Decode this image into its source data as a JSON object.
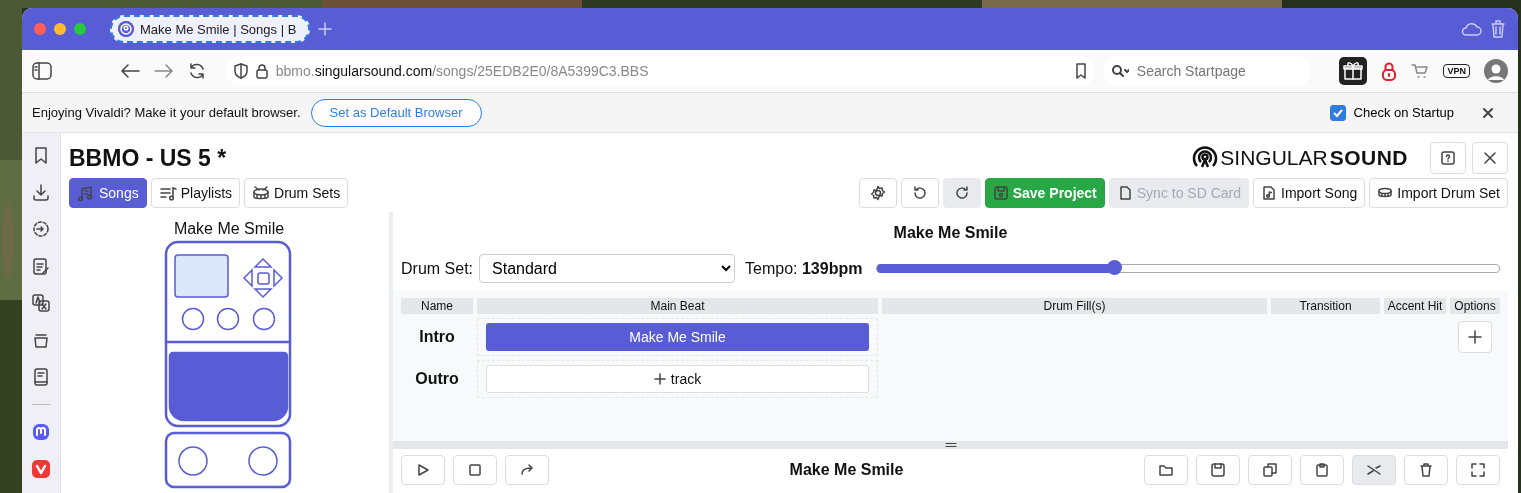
{
  "browser": {
    "tab": {
      "title": "Make Me Smile | Songs | B"
    },
    "address": {
      "host_prefix": "bbmo.",
      "host": "singularsound.com",
      "path": "/songs/25EDB2E0/8A5399C3.BBS"
    },
    "search": {
      "placeholder": "Search Startpage"
    },
    "vpn_badge": "VPN",
    "notice": {
      "text": "Enjoying Vivaldi? Make it your default browser.",
      "button": "Set as Default Browser",
      "checkbox": {
        "label": "Check on Startup",
        "checked": true
      }
    }
  },
  "app": {
    "title": "BBMO - US 5 *",
    "logo": {
      "light": "SINGULAR",
      "bold": "SOUND"
    },
    "tabs": [
      {
        "label": "Songs",
        "selected": true
      },
      {
        "label": "Playlists",
        "selected": false
      },
      {
        "label": "Drum Sets",
        "selected": false
      }
    ],
    "actions": [
      {
        "kind": "icon",
        "disabled": false
      },
      {
        "kind": "icon",
        "disabled": false
      },
      {
        "kind": "icon",
        "disabled": true
      },
      {
        "kind": "primary",
        "label": "Save Project",
        "disabled": false
      },
      {
        "kind": "plain",
        "label": "Sync to SD Card",
        "disabled": true
      },
      {
        "kind": "plain",
        "label": "Import Song",
        "disabled": false
      },
      {
        "kind": "plain",
        "label": "Import Drum Set",
        "disabled": false
      }
    ],
    "pedal": {
      "song": "Make Me Smile"
    },
    "song": {
      "title": "Make Me Smile",
      "drum_set_label": "Drum Set:",
      "drum_set": "Standard",
      "tempo": {
        "label": "Tempo: **139bpm**",
        "level": 0.38
      }
    },
    "table": {
      "columns": [
        "Name",
        "Main Beat",
        "Drum Fill(s)",
        "Transition",
        "Accent Hit",
        "Options"
      ],
      "rows": [
        {
          "name": "Intro",
          "main_beat": {
            "kind": "song",
            "label": "Make Me Smile"
          },
          "option_button": true
        },
        {
          "name": "Outro",
          "main_beat": {
            "kind": "add",
            "label": "track"
          },
          "option_button": false
        }
      ]
    },
    "editor": {
      "title": "Make Me Smile",
      "left_tools": [
        {
          "disabled": false
        },
        {
          "disabled": false
        },
        {
          "disabled": false
        }
      ],
      "right_tools": [
        {
          "disabled": false
        },
        {
          "disabled": false
        },
        {
          "disabled": false
        },
        {
          "disabled": false
        },
        {
          "disabled": true
        },
        {
          "disabled": false
        },
        {
          "disabled": false
        }
      ]
    }
  }
}
